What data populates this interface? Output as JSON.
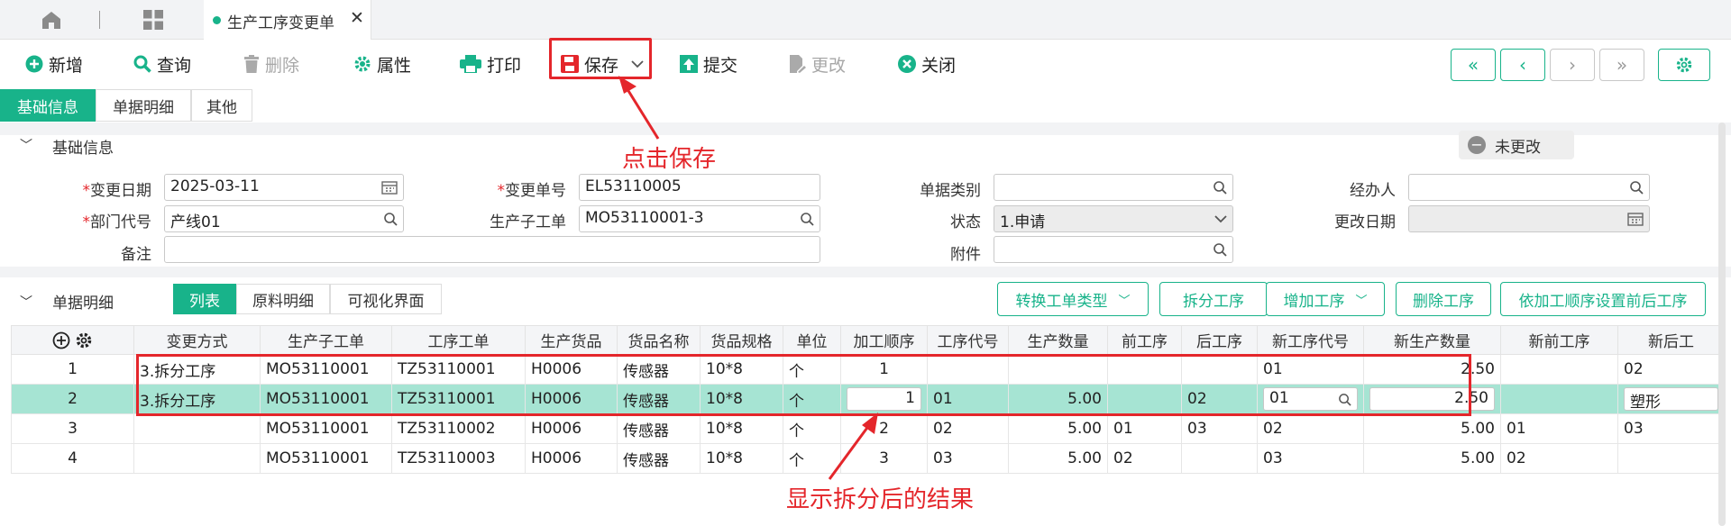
{
  "tabs": {
    "active_doc": "生产工序变更单"
  },
  "toolbar": {
    "new": "新增",
    "query": "查询",
    "delete": "删除",
    "props": "属性",
    "print": "打印",
    "save": "保存",
    "submit": "提交",
    "modify": "更改",
    "close": "关闭"
  },
  "subtabs": [
    "基础信息",
    "单据明细",
    "其他"
  ],
  "basic": {
    "title": "基础信息",
    "status_badge": "未更改",
    "labels": {
      "change_date": "变更日期",
      "change_no": "变更单号",
      "doc_type": "单据类别",
      "handler": "经办人",
      "dept": "部门代号",
      "sub_order": "生产子工单",
      "status": "状态",
      "modify_date": "更改日期",
      "remark": "备注",
      "attachment": "附件"
    },
    "values": {
      "change_date": "2025-03-11",
      "change_no": "EL53110005",
      "doc_type": "",
      "handler": "",
      "dept": "产线01",
      "sub_order": "MO53110001-3",
      "status": "1.申请",
      "modify_date": "",
      "remark": "",
      "attachment": ""
    }
  },
  "detail": {
    "title": "单据明细",
    "tabs": [
      "列表",
      "原料明细",
      "可视化界面"
    ],
    "buttons": [
      "转换工单类型",
      "拆分工序",
      "增加工序",
      "删除工序",
      "依加工顺序设置前后工序"
    ],
    "columns": [
      "变更方式",
      "生产子工单",
      "工序工单",
      "生产货品",
      "货品名称",
      "货品规格",
      "单位",
      "加工顺序",
      "工序代号",
      "生产数量",
      "前工序",
      "后工序",
      "新工序代号",
      "新生产数量",
      "新前工序",
      "新后工"
    ],
    "rows": [
      {
        "no": "1",
        "mode": "3.拆分工序",
        "sub": "MO53110001",
        "op_order": "TZ53110001",
        "item": "H0006",
        "name": "传感器",
        "spec": "10*8",
        "unit": "个",
        "seq": "1",
        "op": "",
        "qty": "",
        "prev": "",
        "next": "",
        "new_op": "01",
        "new_qty": "2.50",
        "new_prev": "",
        "new_next": "02"
      },
      {
        "no": "2",
        "mode": "3.拆分工序",
        "sub": "MO53110001",
        "op_order": "TZ53110001",
        "item": "H0006",
        "name": "传感器",
        "spec": "10*8",
        "unit": "个",
        "seq": "1",
        "op": "01",
        "qty": "5.00",
        "prev": "",
        "next": "02",
        "new_op": "01",
        "new_qty": "2.50",
        "new_prev": "",
        "new_next": "塑形"
      },
      {
        "no": "3",
        "mode": "",
        "sub": "MO53110001",
        "op_order": "TZ53110002",
        "item": "H0006",
        "name": "传感器",
        "spec": "10*8",
        "unit": "个",
        "seq": "2",
        "op": "02",
        "qty": "5.00",
        "prev": "01",
        "next": "03",
        "new_op": "02",
        "new_qty": "5.00",
        "new_prev": "01",
        "new_next": "03"
      },
      {
        "no": "4",
        "mode": "",
        "sub": "MO53110001",
        "op_order": "TZ53110003",
        "item": "H0006",
        "name": "传感器",
        "spec": "10*8",
        "unit": "个",
        "seq": "3",
        "op": "03",
        "qty": "5.00",
        "prev": "02",
        "next": "",
        "new_op": "03",
        "new_qty": "5.00",
        "new_prev": "02",
        "new_next": ""
      }
    ]
  },
  "annotations": {
    "save_hint": "点击保存",
    "result_hint": "显示拆分后的结果"
  },
  "colors": {
    "accent": "#18b38a",
    "annotation": "#e4262b",
    "selected_row": "#a6e4d3"
  }
}
